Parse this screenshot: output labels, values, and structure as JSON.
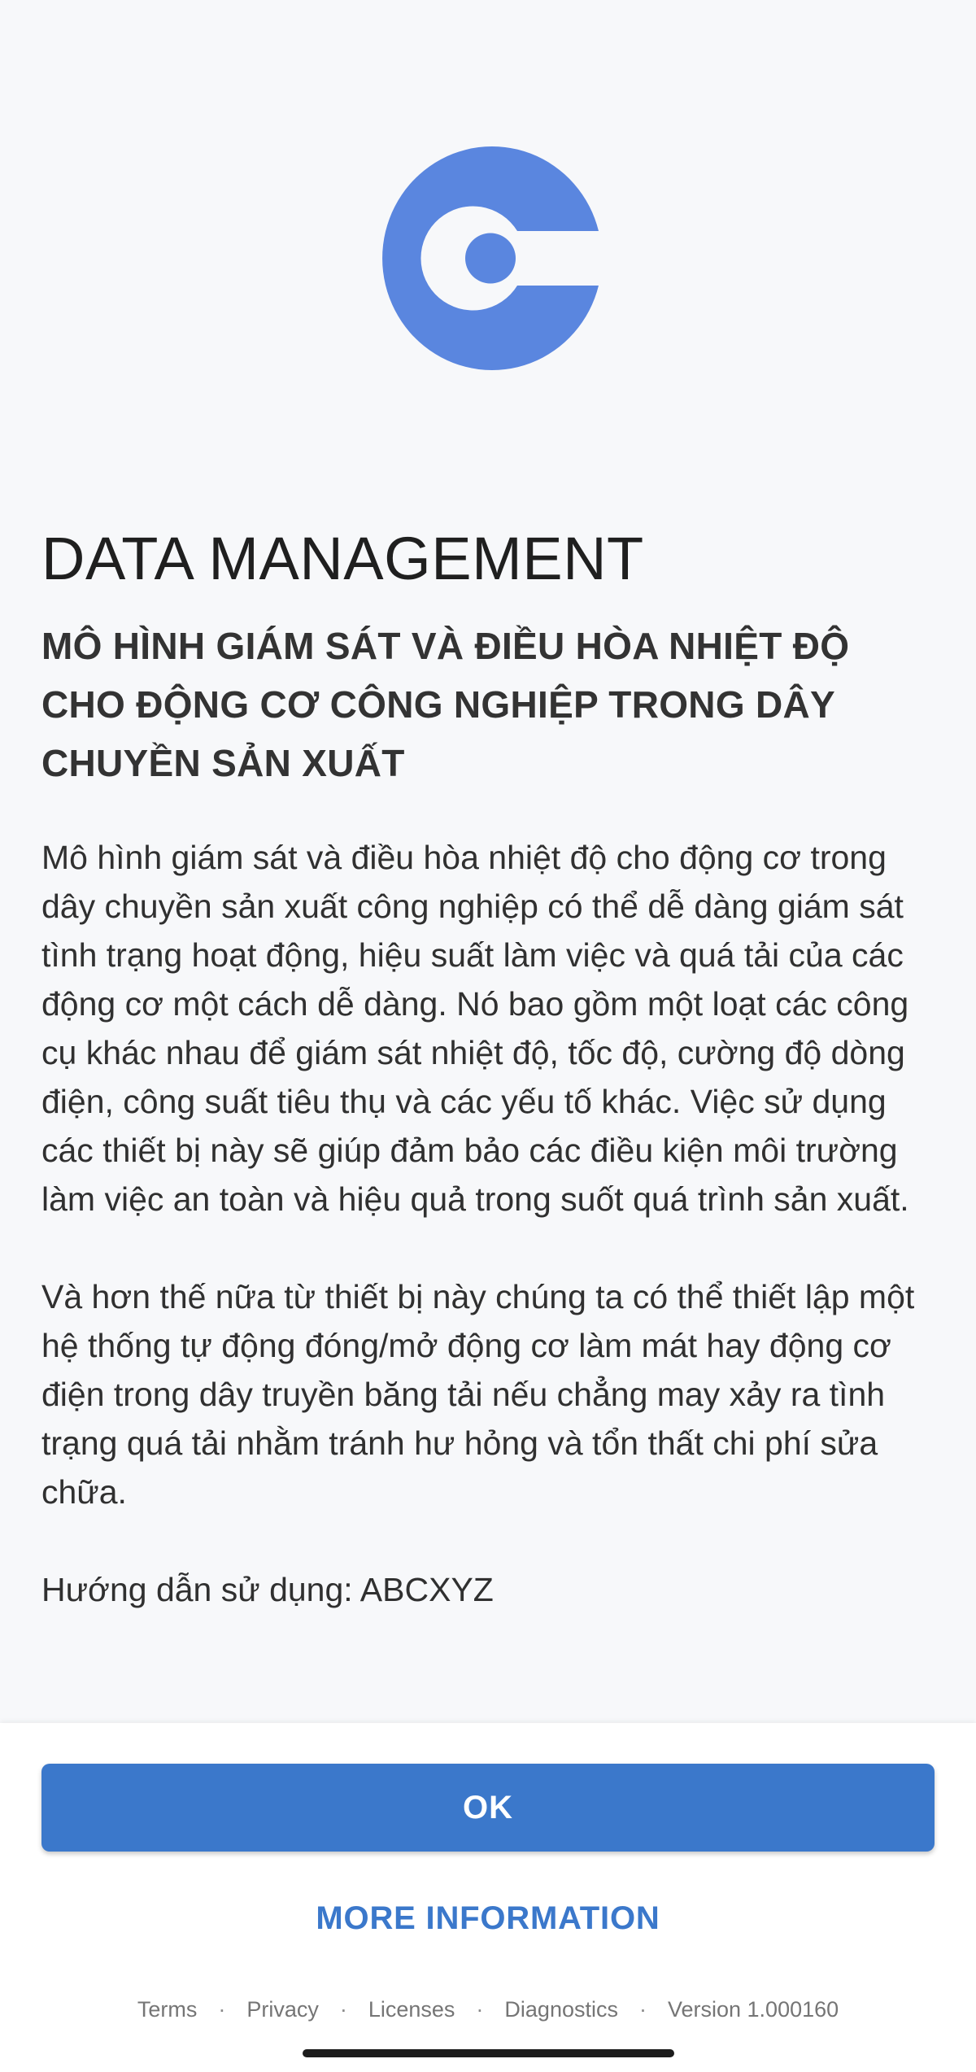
{
  "logo": {
    "icon": "circleci-style-logo-icon",
    "color": "#5a86df"
  },
  "main": {
    "title": "DATA MANAGEMENT",
    "subtitle": "MÔ HÌNH GIÁM SÁT VÀ ĐIỀU HÒA NHIỆT ĐỘ CHO ĐỘNG CƠ CÔNG NGHIỆP TRONG DÂY CHUYỀN SẢN XUẤT",
    "paragraphs": [
      "Mô hình giám sát và điều hòa nhiệt độ cho động cơ trong dây chuyền sản xuất công nghiệp có thể dễ dàng giám sát tình trạng hoạt động, hiệu suất làm việc và quá tải của các động cơ một cách dễ dàng. Nó bao gồm một loạt các công cụ khác nhau để giám sát nhiệt độ, tốc độ, cường độ dòng điện, công suất tiêu thụ và các yếu tố khác. Việc sử dụng các thiết bị này sẽ giúp đảm bảo các điều kiện môi trường làm việc an toàn và hiệu quả trong suốt quá trình sản xuất.",
      "Và hơn thế nữa từ thiết bị này chúng ta có thể thiết lập một hệ thống tự động đóng/mở động cơ làm mát hay động cơ điện trong dây truyền băng tải nếu chẳng may xảy ra tình trạng quá tải nhằm tránh hư hỏng và tổn thất chi phí sửa chữa.",
      "Hướng dẫn sử dụng: ABCXYZ"
    ]
  },
  "actions": {
    "ok_label": "OK",
    "more_info_label": "MORE INFORMATION"
  },
  "footer": {
    "separator": "·",
    "links": [
      "Terms",
      "Privacy",
      "Licenses",
      "Diagnostics"
    ],
    "version": "Version 1.000160"
  },
  "colors": {
    "accent": "#3b78cb",
    "background": "#f7f8fa"
  }
}
